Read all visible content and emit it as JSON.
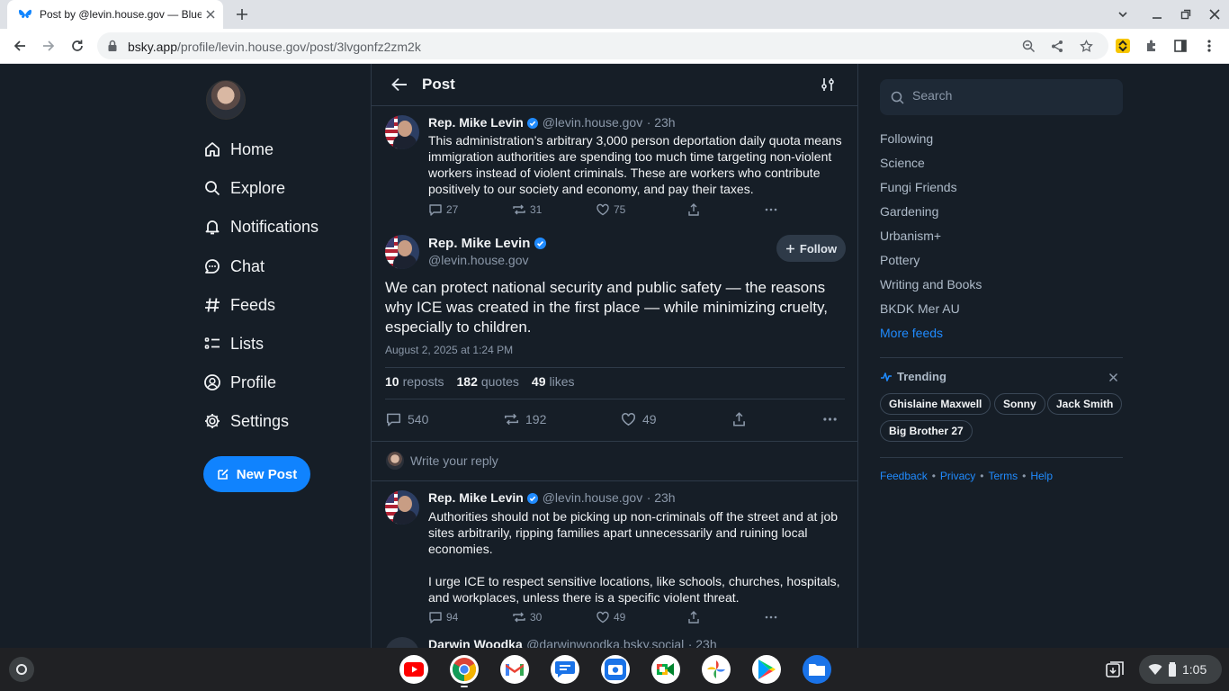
{
  "browser": {
    "tab_title": "Post by @levin.house.gov — Bluesky",
    "url_host": "bsky.app",
    "url_path": "/profile/levin.house.gov/post/3lvgonfz2zm2k"
  },
  "nav": {
    "items": [
      {
        "label": "Home",
        "icon": "home-icon"
      },
      {
        "label": "Explore",
        "icon": "search-icon"
      },
      {
        "label": "Notifications",
        "icon": "bell-icon"
      },
      {
        "label": "Chat",
        "icon": "chat-icon"
      },
      {
        "label": "Feeds",
        "icon": "hash-icon"
      },
      {
        "label": "Lists",
        "icon": "list-icon"
      },
      {
        "label": "Profile",
        "icon": "user-icon"
      },
      {
        "label": "Settings",
        "icon": "gear-icon"
      }
    ],
    "new_post": "New Post"
  },
  "header": {
    "title": "Post"
  },
  "parent_post": {
    "author": "Rep. Mike Levin",
    "handle": "@levin.house.gov",
    "time": "· 23h",
    "text": "This administration’s arbitrary 3,000 person deportation daily quota means immigration authorities are spending too much time targeting non-violent workers instead of violent criminals. These are workers who contribute positively to our society and economy, and pay their taxes.",
    "replies": "27",
    "reposts": "31",
    "likes": "75"
  },
  "main_post": {
    "author": "Rep. Mike Levin",
    "handle": "@levin.house.gov",
    "follow": "Follow",
    "text": "We can protect national security and public safety — the reasons why ICE was created in the first place — while minimizing cruelty, especially to children.",
    "timestamp": "August 2, 2025 at 1:24 PM",
    "reposts_count": "10",
    "reposts_label": "reposts",
    "quotes_count": "182",
    "quotes_label": "quotes",
    "likes_count": "49",
    "likes_label": "likes",
    "replies": "540",
    "reposts": "192",
    "likes": "49"
  },
  "reply_box": {
    "placeholder": "Write your reply"
  },
  "reply_post": {
    "author": "Rep. Mike Levin",
    "handle": "@levin.house.gov",
    "time": "· 23h",
    "text1": "Authorities should not be picking up non-criminals off the street and at job sites arbitrarily, ripping families apart unnecessarily and ruining local economies.",
    "text2": "I urge ICE to respect sensitive locations, like schools, churches, hospitals, and workplaces, unless there is a specific violent threat.",
    "replies": "94",
    "reposts": "30",
    "likes": "49"
  },
  "next_post": {
    "author": "Darwin Woodka",
    "handle": "@darwinwoodka.bsky.social",
    "time": "· 23h"
  },
  "sidebar": {
    "search_placeholder": "Search",
    "feeds": [
      "Following",
      "Science",
      "Fungi Friends",
      "Gardening",
      "Urbanism+",
      "Pottery",
      "Writing and Books",
      "BKDK Mer AU"
    ],
    "more_feeds": "More feeds",
    "trending_title": "Trending",
    "trending": [
      "Ghislaine Maxwell",
      "Sonny",
      "Jack Smith",
      "Big Brother 27"
    ],
    "footer": [
      "Feedback",
      "Privacy",
      "Terms",
      "Help"
    ]
  },
  "shelf": {
    "apps": [
      "youtube-icon",
      "chrome-icon",
      "gmail-icon",
      "messages-icon",
      "camera-icon",
      "meet-icon",
      "photos-icon",
      "play-store-icon",
      "files-icon"
    ],
    "time": "1:05"
  },
  "colors": {
    "accent": "#1083fe",
    "background": "#161e27",
    "link": "#208bfe"
  }
}
